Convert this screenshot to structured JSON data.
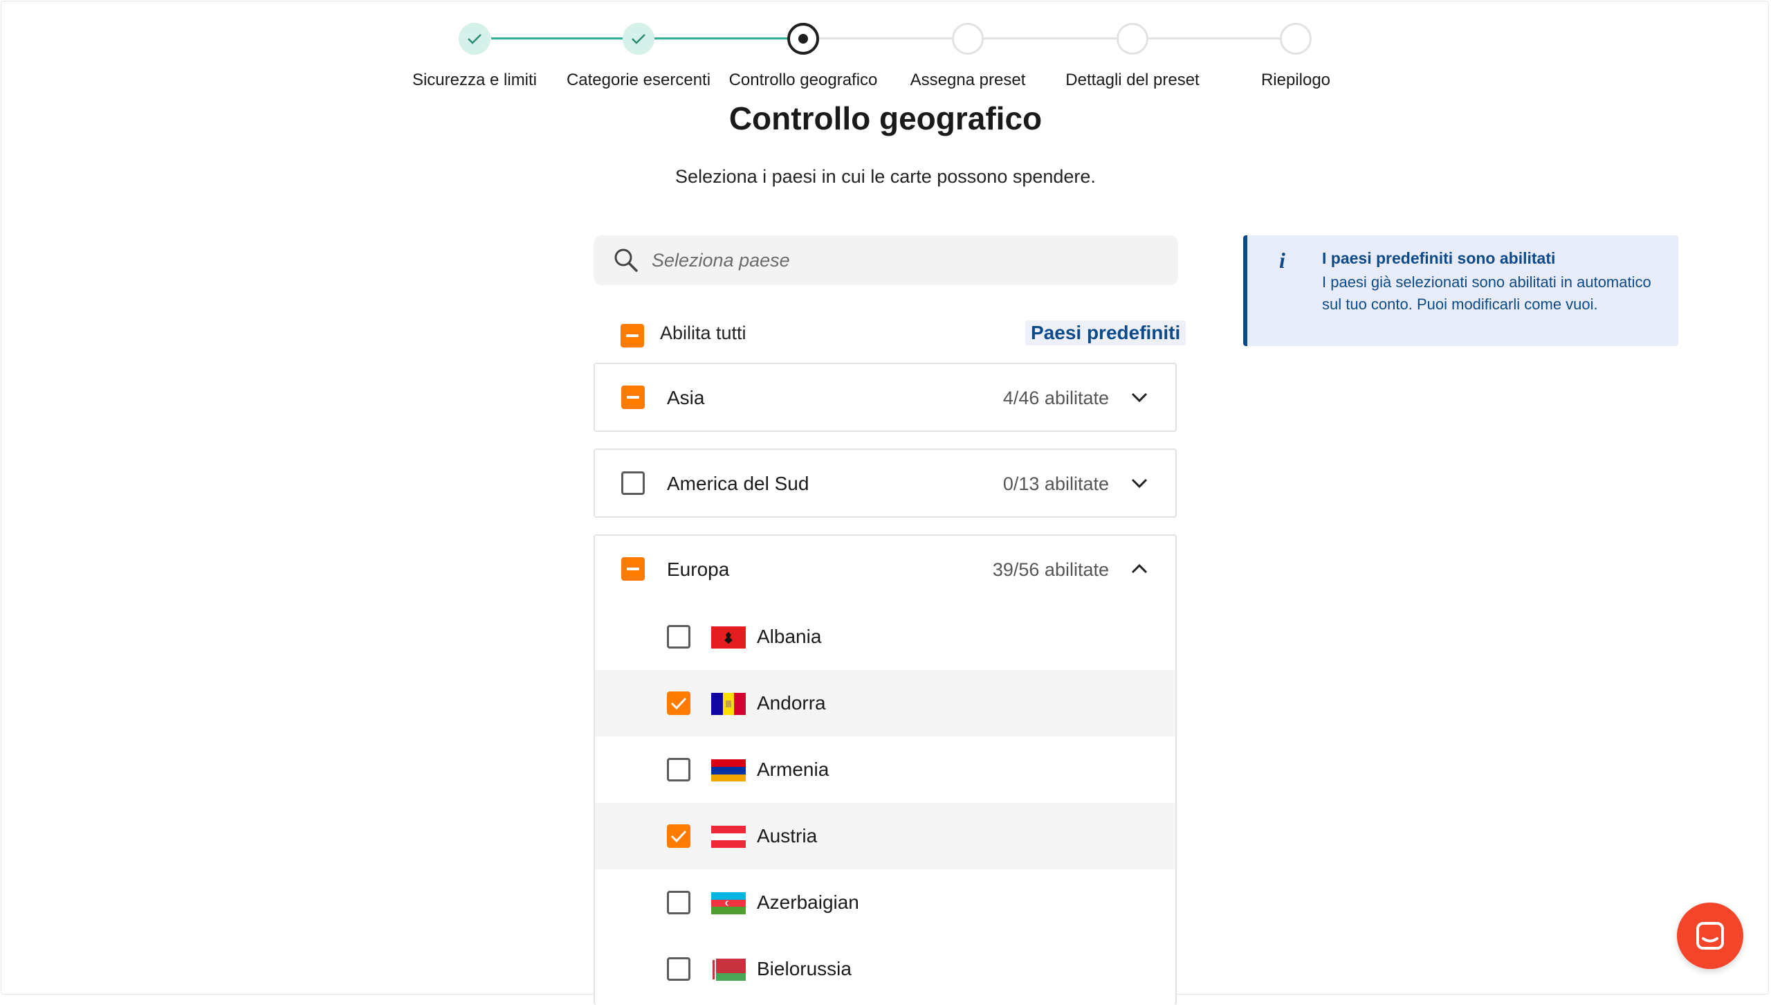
{
  "stepper": {
    "steps": [
      {
        "label": "Sicurezza e limiti",
        "status": "done"
      },
      {
        "label": "Categorie esercenti",
        "status": "done"
      },
      {
        "label": "Controllo geografico",
        "status": "current"
      },
      {
        "label": "Assegna preset",
        "status": "pending"
      },
      {
        "label": "Dettagli del preset",
        "status": "pending"
      },
      {
        "label": "Riepilogo",
        "status": "pending"
      }
    ]
  },
  "header": {
    "title": "Controllo geografico",
    "subtitle": "Seleziona i paesi in cui le carte possono spendere."
  },
  "search": {
    "placeholder": "Seleziona paese"
  },
  "enable_all": {
    "label": "Abilita tutti",
    "state": "indeterminate"
  },
  "preset_link": "Paesi predefiniti",
  "regions": [
    {
      "name": "Asia",
      "count": "4/46 abilitate",
      "state": "indeterminate",
      "expanded": false
    },
    {
      "name": "America del Sud",
      "count": "0/13 abilitate",
      "state": "unchecked",
      "expanded": false
    },
    {
      "name": "Europa",
      "count": "39/56 abilitate",
      "state": "indeterminate",
      "expanded": true,
      "countries": [
        {
          "name": "Albania",
          "checked": false,
          "flag": "albania-flag-icon"
        },
        {
          "name": "Andorra",
          "checked": true,
          "flag": "andorra-flag-icon"
        },
        {
          "name": "Armenia",
          "checked": false,
          "flag": "armenia-flag-icon"
        },
        {
          "name": "Austria",
          "checked": true,
          "flag": "austria-flag-icon"
        },
        {
          "name": "Azerbaigian",
          "checked": false,
          "flag": "azerbaijan-flag-icon"
        },
        {
          "name": "Bielorussia",
          "checked": false,
          "flag": "belarus-flag-icon"
        }
      ]
    }
  ],
  "info": {
    "icon": "info-icon",
    "glyph": "i",
    "title": "I paesi predefiniti sono abilitati",
    "text": "I paesi già selezionati sono abilitati in automatico sul tuo conto. Puoi modificarli come vuoi."
  },
  "colors": {
    "accent": "#ff7a00",
    "done": "#2fae95",
    "link": "#0c4a8a",
    "chat": "#f2452a"
  },
  "chat": {
    "icon": "chat-icon"
  }
}
